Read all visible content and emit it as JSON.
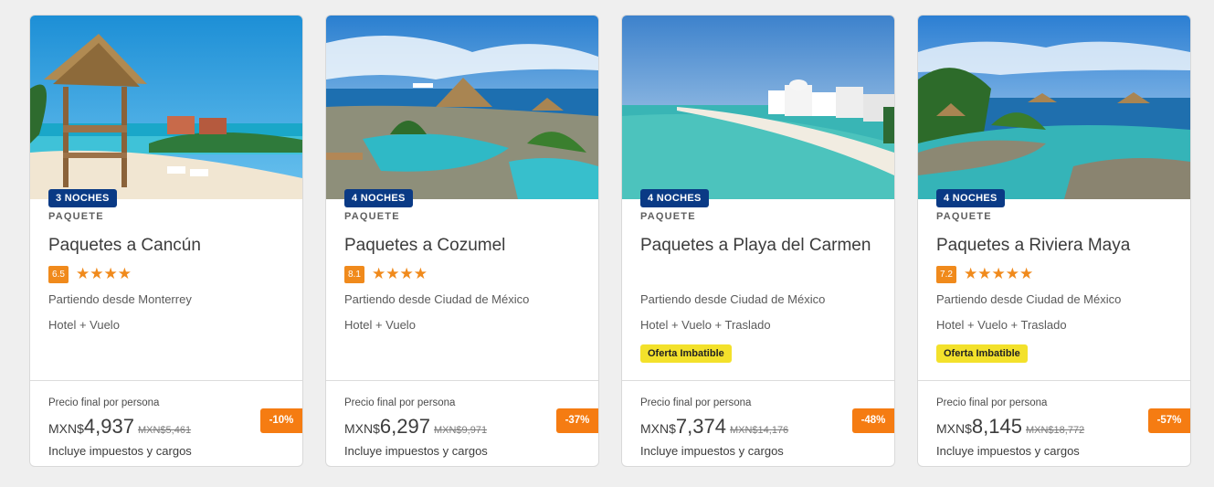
{
  "cards": [
    {
      "nights": "3 NOCHES",
      "type": "PAQUETE",
      "title": "Paquetes a Cancún",
      "score": "6.5",
      "stars": "★★★★",
      "origin": "Partiendo desde Monterrey",
      "includes": "Hotel + Vuelo",
      "deal": "",
      "price_label": "Precio final por persona",
      "currency": "MXN$",
      "price": "4,937",
      "old_price": "MXN$5,461",
      "taxes": "Incluye impuestos y cargos",
      "discount": "-10%"
    },
    {
      "nights": "4 NOCHES",
      "type": "PAQUETE",
      "title": "Paquetes a Cozumel",
      "score": "8.1",
      "stars": "★★★★",
      "origin": "Partiendo desde Ciudad de México",
      "includes": "Hotel + Vuelo",
      "deal": "",
      "price_label": "Precio final por persona",
      "currency": "MXN$",
      "price": "6,297",
      "old_price": "MXN$9,971",
      "taxes": "Incluye impuestos y cargos",
      "discount": "-37%"
    },
    {
      "nights": "4 NOCHES",
      "type": "PAQUETE",
      "title": "Paquetes a Playa del Carmen",
      "score": "",
      "stars": "",
      "origin": "Partiendo desde Ciudad de México",
      "includes": "Hotel + Vuelo + Traslado",
      "deal": "Oferta Imbatible",
      "price_label": "Precio final por persona",
      "currency": "MXN$",
      "price": "7,374",
      "old_price": "MXN$14,176",
      "taxes": "Incluye impuestos y cargos",
      "discount": "-48%"
    },
    {
      "nights": "4 NOCHES",
      "type": "PAQUETE",
      "title": "Paquetes a Riviera Maya",
      "score": "7.2",
      "stars": "★★★★★",
      "origin": "Partiendo desde Ciudad de México",
      "includes": "Hotel + Vuelo + Traslado",
      "deal": "Oferta Imbatible",
      "price_label": "Precio final por persona",
      "currency": "MXN$",
      "price": "8,145",
      "old_price": "MXN$18,772",
      "taxes": "Incluye impuestos y cargos",
      "discount": "-57%"
    }
  ],
  "colors": {
    "nights_badge": "#0a3a85",
    "score_badge": "#f08a1c",
    "deal_badge": "#f3e12b",
    "discount_badge": "#f57c12"
  }
}
